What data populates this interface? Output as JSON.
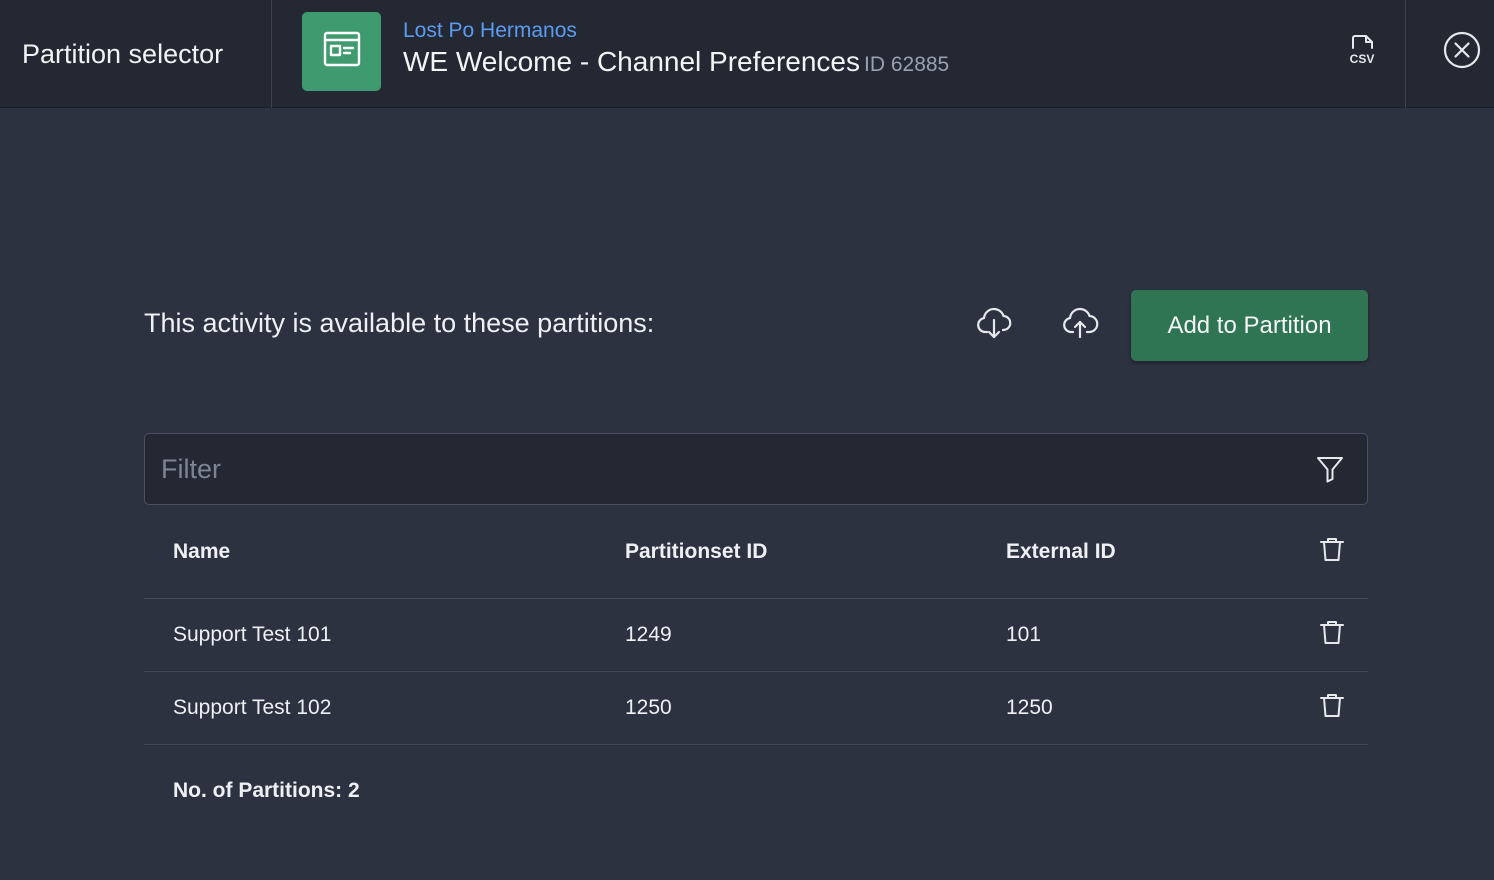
{
  "header": {
    "title": "Partition selector",
    "org_name": "Lost Po Hermanos",
    "activity_title": "WE Welcome - Channel Preferences",
    "activity_id": "ID 62885",
    "csv_label": "CSV"
  },
  "main": {
    "intro_text": "This activity is available to these partitions:",
    "add_button_label": "Add to Partition",
    "filter_placeholder": "Filter"
  },
  "table": {
    "columns": [
      "Name",
      "Partitionset ID",
      "External ID"
    ],
    "rows": [
      {
        "name": "Support Test 101",
        "partitionset_id": "1249",
        "external_id": "101"
      },
      {
        "name": "Support Test 102",
        "partitionset_id": "1250",
        "external_id": "1250"
      }
    ]
  },
  "footer": {
    "count_label": "No. of Partitions:",
    "count_value": "2"
  },
  "icons": {
    "activity": "activity-window-icon",
    "csv": "csv-export-icon",
    "close": "close-circle-icon",
    "download": "cloud-download-icon",
    "upload": "cloud-upload-icon",
    "filter": "funnel-filter-icon",
    "delete": "trash-icon"
  },
  "colors": {
    "background": "#2c3240",
    "header": "#232833",
    "accent_green": "#2f7453",
    "badge_green": "#3f9a6f",
    "link_blue": "#5b9cf0"
  }
}
